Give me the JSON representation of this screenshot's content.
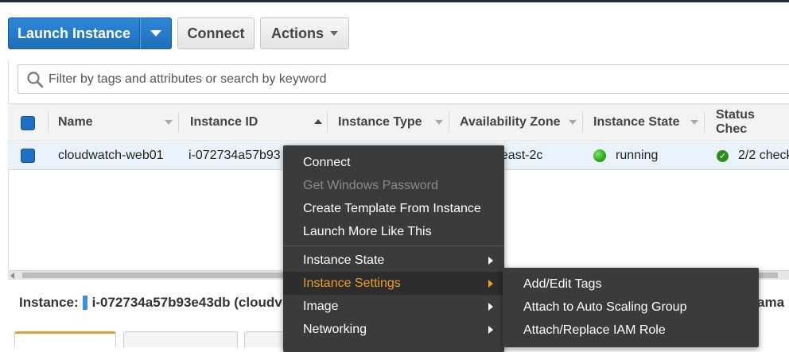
{
  "toolbar": {
    "launch_label": "Launch Instance",
    "connect_label": "Connect",
    "actions_label": "Actions"
  },
  "search": {
    "placeholder": "Filter by tags and attributes or search by keyword"
  },
  "table": {
    "columns": [
      "Name",
      "Instance ID",
      "Instance Type",
      "Availability Zone",
      "Instance State",
      "Status Chec"
    ],
    "rows": [
      {
        "name": "cloudwatch-web01",
        "instance_id": "i-072734a57b93",
        "availability_zone": "heast-2c",
        "instance_state": "running",
        "status_checks": "2/2 check"
      }
    ]
  },
  "detail": {
    "label": "Instance:",
    "value": "i-072734a57b93e43db (cloudv",
    "right_text": "ama"
  },
  "context_menu": {
    "items": [
      {
        "label": "Connect",
        "state": "normal"
      },
      {
        "label": "Get Windows Password",
        "state": "disabled"
      },
      {
        "label": "Create Template From Instance",
        "state": "normal"
      },
      {
        "label": "Launch More Like This",
        "state": "normal"
      },
      {
        "label": "Instance State",
        "state": "submenu"
      },
      {
        "label": "Instance Settings",
        "state": "active-submenu"
      },
      {
        "label": "Image",
        "state": "submenu"
      },
      {
        "label": "Networking",
        "state": "submenu"
      }
    ]
  },
  "submenu": {
    "items": [
      {
        "label": "Add/Edit Tags"
      },
      {
        "label": "Attach to Auto Scaling Group"
      },
      {
        "label": "Attach/Replace IAM Role"
      }
    ]
  },
  "colors": {
    "primary_blue": "#1f6fb8",
    "menu_bg": "#3b3b3b",
    "menu_active": "#ec9b2d",
    "running_green": "#2fa615"
  },
  "icons": [
    "search-icon",
    "dropdown-caret-icon",
    "sort-asc-icon",
    "running-status-icon",
    "check-icon",
    "submenu-arrow-icon"
  ]
}
